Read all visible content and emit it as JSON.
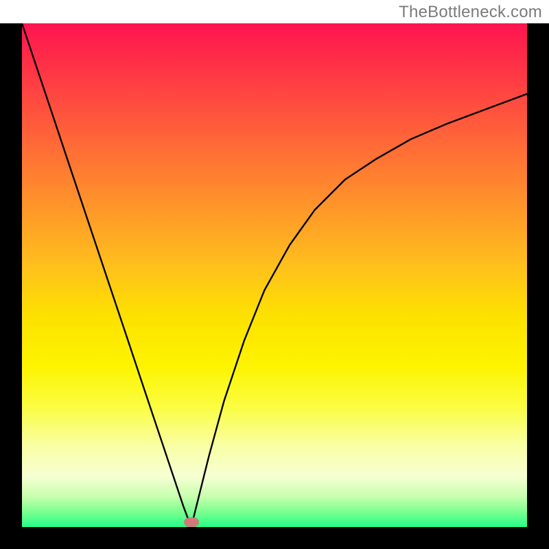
{
  "attribution": "TheBottleneck.com",
  "chart_data": {
    "type": "line",
    "title": "",
    "xlabel": "",
    "ylabel": "",
    "xlim": [
      0,
      100
    ],
    "ylim": [
      0,
      100
    ],
    "optimum_x": 33.5,
    "optimum_y": 0,
    "marker": {
      "x_pct": 33.5,
      "y_pct": 99.0,
      "color": "#cf7a78"
    },
    "gradient_stops": [
      {
        "pos": 0.0,
        "color": "#ff1450"
      },
      {
        "pos": 0.06,
        "color": "#ff2949"
      },
      {
        "pos": 0.2,
        "color": "#ff5b3b"
      },
      {
        "pos": 0.34,
        "color": "#ff8d2c"
      },
      {
        "pos": 0.48,
        "color": "#ffbf1d"
      },
      {
        "pos": 0.58,
        "color": "#fde100"
      },
      {
        "pos": 0.68,
        "color": "#fdf400"
      },
      {
        "pos": 0.76,
        "color": "#fbfd40"
      },
      {
        "pos": 0.84,
        "color": "#f9ffa6"
      },
      {
        "pos": 0.9,
        "color": "#f6ffd3"
      },
      {
        "pos": 0.94,
        "color": "#c6ffae"
      },
      {
        "pos": 0.97,
        "color": "#7bff8f"
      },
      {
        "pos": 1.0,
        "color": "#22ff88"
      }
    ],
    "series": [
      {
        "name": "left-branch",
        "x": [
          0,
          3,
          6,
          9,
          12,
          15,
          18,
          21,
          24,
          27,
          30,
          32,
          33.5
        ],
        "values": [
          100,
          91,
          82,
          73,
          64,
          55,
          46,
          37,
          28,
          19,
          10,
          4,
          0
        ]
      },
      {
        "name": "right-branch",
        "x": [
          33.5,
          35,
          37,
          40,
          44,
          48,
          53,
          58,
          64,
          70,
          77,
          84,
          92,
          100
        ],
        "values": [
          0,
          6,
          14,
          25,
          37,
          47,
          56,
          63,
          69,
          73,
          77,
          80,
          83,
          86
        ]
      }
    ]
  }
}
